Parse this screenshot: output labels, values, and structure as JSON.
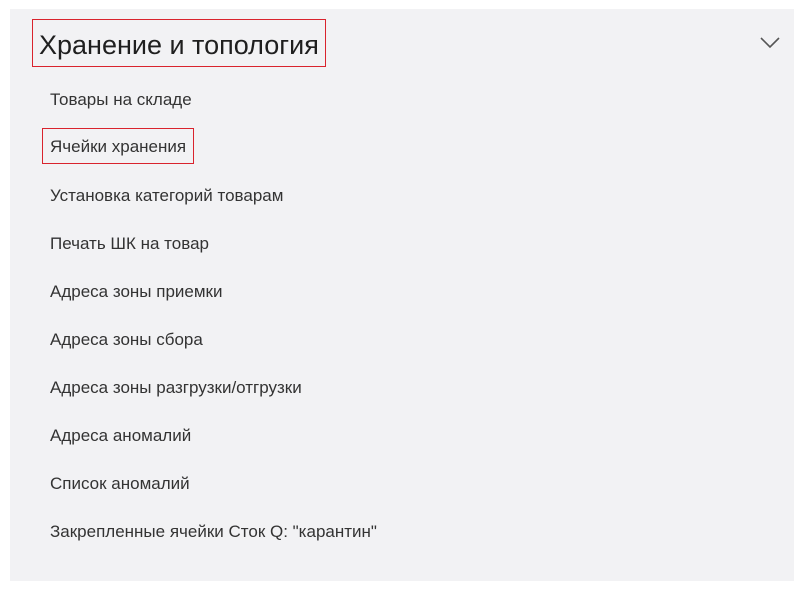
{
  "section": {
    "title": "Хранение и топология",
    "expanded": true,
    "toggle_icon": "chevron-down-icon",
    "highlight_color": "#d9232d"
  },
  "menu": {
    "items": [
      {
        "label": "Товары на складе"
      },
      {
        "label": "Ячейки хранения",
        "highlighted": true
      },
      {
        "label": "Установка категорий товарам"
      },
      {
        "label": "Печать ШК на товар"
      },
      {
        "label": "Адреса зоны приемки"
      },
      {
        "label": "Адреса зоны сбора"
      },
      {
        "label": "Адреса зоны разгрузки/отгрузки"
      },
      {
        "label": "Адреса аномалий"
      },
      {
        "label": "Список аномалий"
      },
      {
        "label": "Закрепленные ячейки Сток Q: \"карантин\""
      }
    ]
  }
}
